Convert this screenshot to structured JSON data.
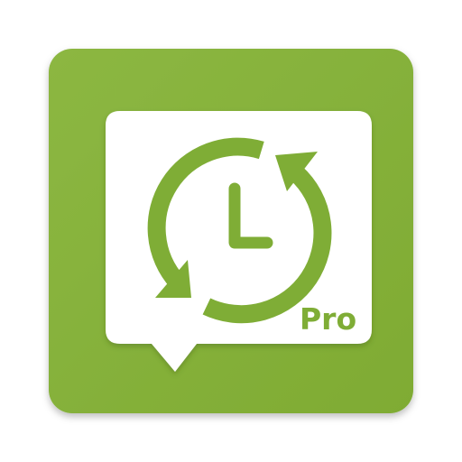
{
  "app_icon": {
    "badge_label": "Pro",
    "colors": {
      "tile_background": "#86b23b",
      "bubble": "#ffffff",
      "symbol_green": "#7fad36"
    },
    "icons": {
      "background": "rounded-square-tile",
      "container": "speech-bubble-icon",
      "symbol": "clock-sync-icon"
    }
  }
}
